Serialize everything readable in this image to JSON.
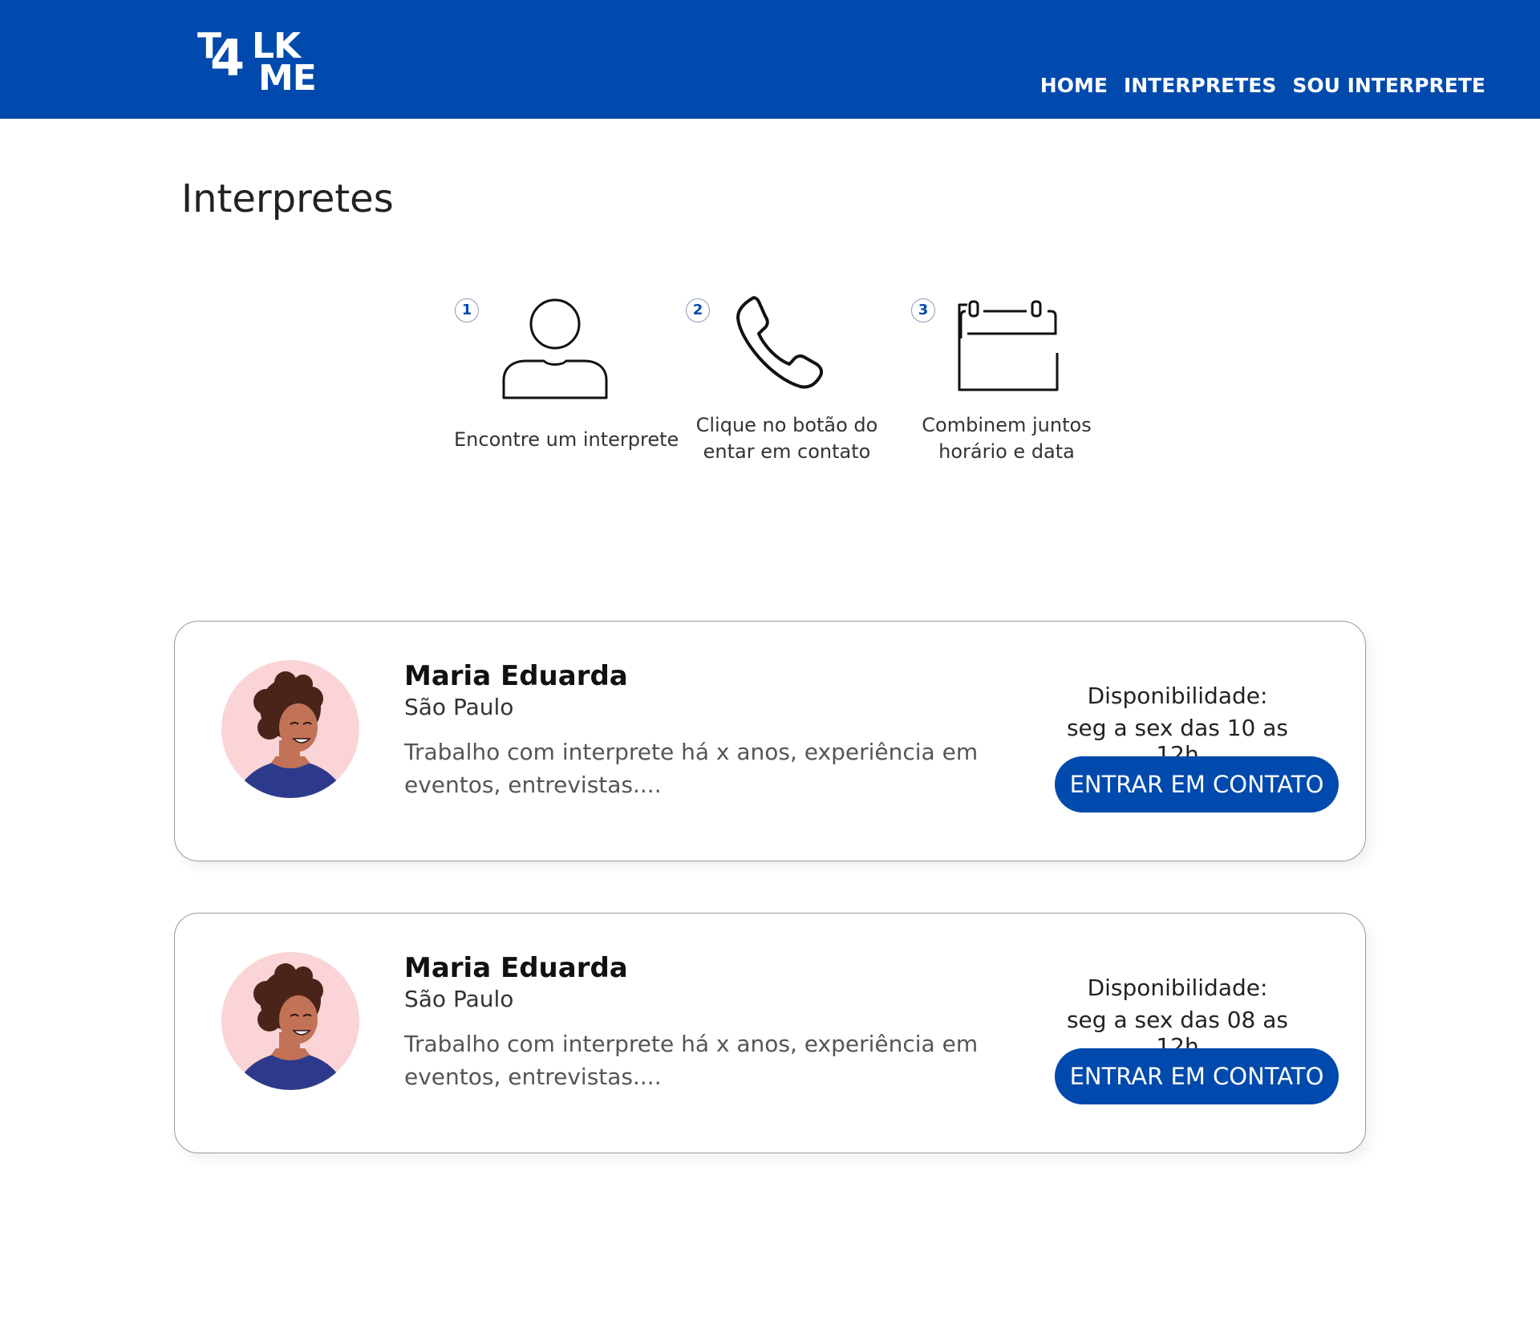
{
  "brand": {
    "logo_t": "T",
    "logo_4": "4",
    "logo_lk": "LK",
    "logo_me": "ME",
    "primary_color": "#004aad"
  },
  "nav": {
    "items": [
      {
        "label": "HOME"
      },
      {
        "label": "INTERPRETES"
      },
      {
        "label": "SOU INTERPRETE"
      }
    ]
  },
  "page": {
    "title": "Interpretes"
  },
  "steps": [
    {
      "number": "1",
      "icon": "user-icon",
      "text_line1": "Encontre um interprete",
      "text_line2": ""
    },
    {
      "number": "2",
      "icon": "phone-icon",
      "text_line1": "Clique no botão do",
      "text_line2": "entar em contato"
    },
    {
      "number": "3",
      "icon": "calendar-icon",
      "text_line1": "Combinem juntos",
      "text_line2": "horário e data"
    }
  ],
  "interpreters": [
    {
      "name": "Maria Eduarda",
      "city": "São Paulo",
      "description": "Trabalho com interprete há x anos, experiência em eventos, entrevistas....",
      "availability_label": "Disponibilidade:",
      "availability": "seg a sex das 10 as 12h",
      "button_label": "ENTRAR EM CONTATO"
    },
    {
      "name": "Maria Eduarda",
      "city": "São Paulo",
      "description": "Trabalho com interprete há x anos, experiência em eventos, entrevistas....",
      "availability_label": "Disponibilidade:",
      "availability": "seg a sex das 08 as 12h",
      "button_label": "ENTRAR EM CONTATO"
    }
  ]
}
